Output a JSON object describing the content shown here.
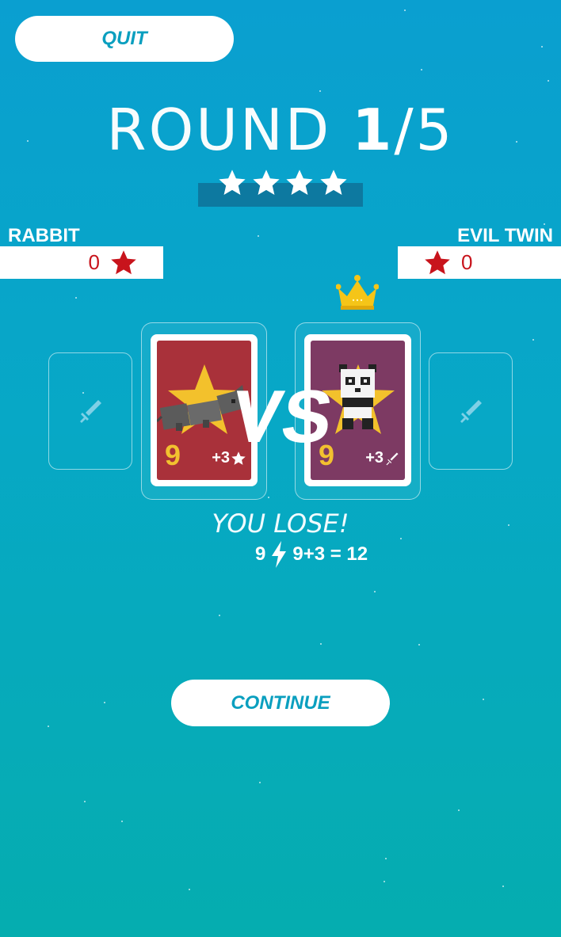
{
  "header": {
    "quit_label": "QUIT"
  },
  "round": {
    "label": "ROUND",
    "current": "1",
    "separator": "/",
    "total": "5",
    "stars_filled": 4,
    "stars_total": 4
  },
  "players": {
    "left": {
      "name": "RABBIT",
      "score": "0"
    },
    "right": {
      "name": "EVIL TWIN",
      "score": "0"
    }
  },
  "cards": {
    "left": {
      "power": "9",
      "bonus": "+3",
      "bonus_icon": "star-icon",
      "color": "#a9313a",
      "character": "rat"
    },
    "right": {
      "power": "9",
      "bonus": "+3",
      "bonus_icon": "sword-icon",
      "color": "#7d3a63",
      "character": "panda"
    }
  },
  "vs_label": "VS",
  "result": {
    "text": "YOU LOSE!",
    "left_value": "9",
    "right_value": "9+3 = 12",
    "separator_icon": "lightning-icon"
  },
  "footer": {
    "continue_label": "CONTINUE"
  },
  "colors": {
    "accent": "#0a9fbf",
    "score_red": "#c8141c",
    "power_yellow": "#f2c12f"
  }
}
